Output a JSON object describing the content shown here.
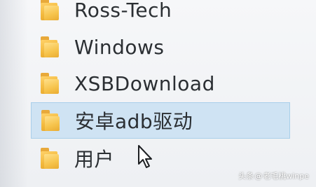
{
  "explorer": {
    "items": [
      {
        "label": "Ross-Tech",
        "icon": "folder-icon",
        "selected": false
      },
      {
        "label": "Windows",
        "icon": "folder-icon",
        "selected": false
      },
      {
        "label": "XSBDownload",
        "icon": "folder-icon",
        "selected": false
      },
      {
        "label": "安卓adb驱动",
        "icon": "folder-icon",
        "selected": true
      },
      {
        "label": "用户",
        "icon": "folder-icon",
        "selected": false
      }
    ],
    "selection_color": "#cfe3f3",
    "folder_color": "#f2b83c"
  },
  "watermark": {
    "prefix": "头条",
    "at": "@",
    "handle": "老毛桃winpe"
  }
}
